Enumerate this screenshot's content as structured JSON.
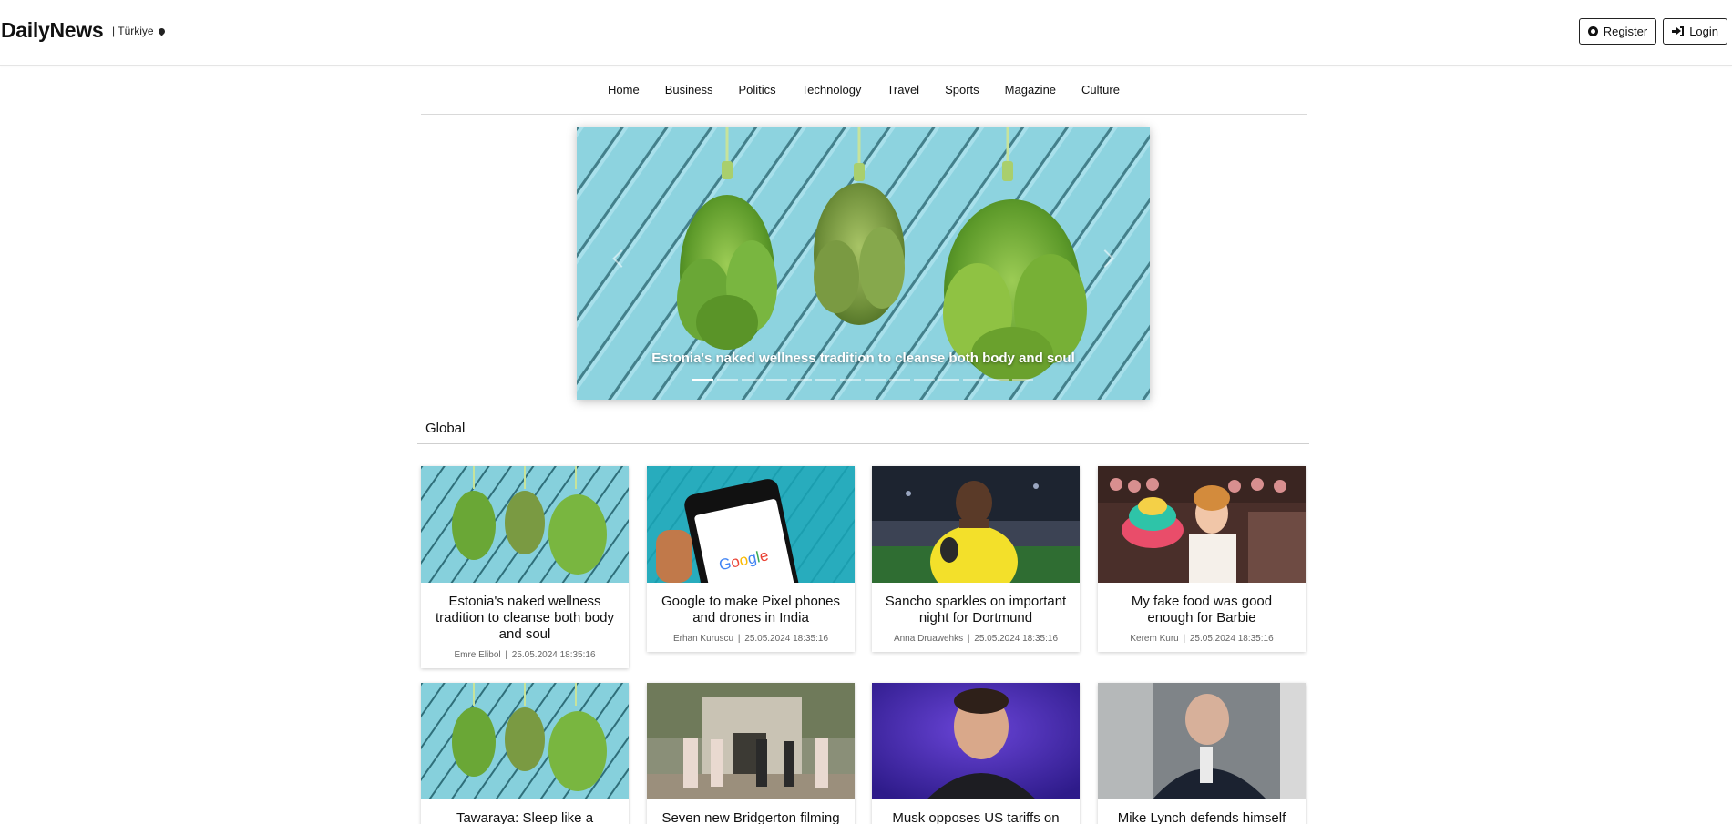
{
  "header": {
    "brand": "DailyNews",
    "region": "| Türkiye",
    "register_label": "Register",
    "login_label": "Login"
  },
  "nav": [
    "Home",
    "Business",
    "Politics",
    "Technology",
    "Travel",
    "Sports",
    "Magazine",
    "Culture"
  ],
  "carousel": {
    "caption": "Estonia's naked wellness tradition to cleanse both body and soul",
    "slide_count": 14,
    "active_index": 0
  },
  "section": {
    "title": "Global"
  },
  "articles": [
    {
      "title": "Estonia's naked wellness tradition to cleanse both body and soul",
      "author": "Emre Elibol",
      "date": "25.05.2024 18:35:16"
    },
    {
      "title": "Google to make Pixel phones and drones in India",
      "author": "Erhan Kuruscu",
      "date": "25.05.2024 18:35:16"
    },
    {
      "title": "Sancho sparkles on important night for Dortmund",
      "author": "Anna Druawehks",
      "date": "25.05.2024 18:35:16"
    },
    {
      "title": "My fake food was good enough for Barbie",
      "author": "Kerem Kuru",
      "date": "25.05.2024 18:35:16"
    },
    {
      "title": "Tawaraya: Sleep like a",
      "author": "",
      "date": ""
    },
    {
      "title": "Seven new Bridgerton filming",
      "author": "",
      "date": ""
    },
    {
      "title": "Musk opposes US tariffs on",
      "author": "",
      "date": ""
    },
    {
      "title": "Mike Lynch defends himself",
      "author": "",
      "date": ""
    }
  ]
}
